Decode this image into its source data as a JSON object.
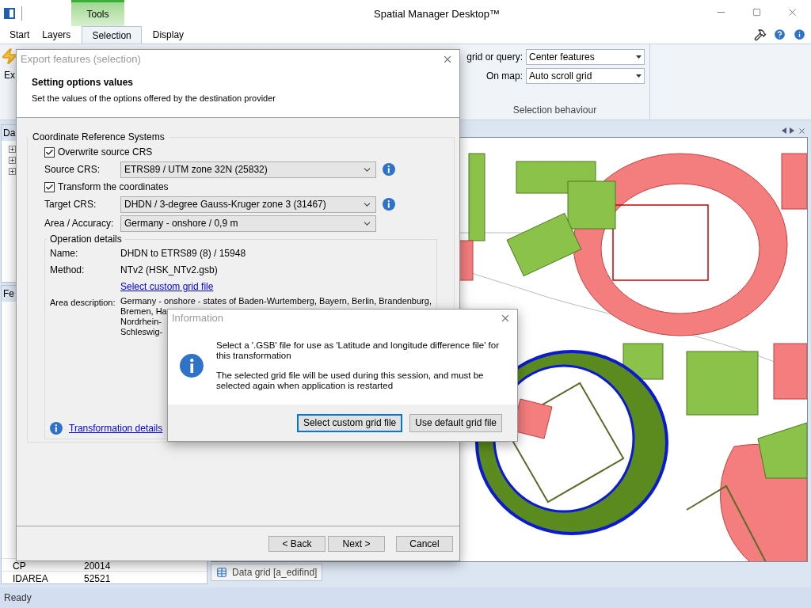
{
  "window": {
    "title": "Spatial Manager Desktop™"
  },
  "contextual_tab": {
    "label": "Tools"
  },
  "tabs": [
    {
      "label": "Start",
      "selected": false
    },
    {
      "label": "Layers",
      "selected": false
    },
    {
      "label": "Selection",
      "selected": true
    },
    {
      "label": "Display",
      "selected": false
    }
  ],
  "ribbon": {
    "partial_label": "Ex",
    "fields": [
      {
        "label": "grid or query:",
        "value": "Center features"
      },
      {
        "label": "On map:",
        "value": "Auto scroll grid"
      }
    ],
    "group_title": "Selection behaviour"
  },
  "left_panel": {
    "data_header": "Da",
    "features_header": "Fe",
    "grid_rows": [
      {
        "name": "CP",
        "value": "20014"
      },
      {
        "name": "IDAREA",
        "value": "52521"
      }
    ]
  },
  "document_tab": {
    "label": "Data grid [a_edifind]"
  },
  "status_bar": {
    "text": "Ready"
  },
  "export_dialog": {
    "title": "Export features (selection)",
    "heading": "Setting options values",
    "subtitle": "Set the values of the options offered by the destination provider",
    "crs_group": {
      "title": "Coordinate Reference Systems",
      "rows": [
        {
          "kind": "checkbox",
          "label": "Overwrite source CRS",
          "checked": true
        },
        {
          "kind": "combo",
          "label": "Source CRS:",
          "value": "ETRS89 / UTM zone 32N (25832)",
          "info": true
        },
        {
          "kind": "checkbox",
          "label": "Transform the coordinates",
          "checked": true
        },
        {
          "kind": "combo",
          "label": "Target CRS:",
          "value": "DHDN / 3-degree Gauss-Kruger zone 3 (31467)",
          "info": true
        },
        {
          "kind": "combo",
          "label": "Area / Accuracy:",
          "value": "Germany - onshore / 0,9 m",
          "info": false
        }
      ]
    },
    "operation_details": {
      "title": "Operation details",
      "name_label": "Name:",
      "name": "DHDN to ETRS89 (8) / 15948",
      "method_label": "Method:",
      "method": "NTv2 (HSK_NTv2.gsb)",
      "grid_link": "Select custom grid file",
      "area_label": "Area description:",
      "area_lines": [
        "Germany - onshore - states of Baden-Wurtemberg, Bayern, Berlin, Brandenburg,",
        "Bremen, Ha",
        "Nordrhein-",
        "Schleswig-"
      ]
    },
    "details_link": "Transformation details",
    "buttons": [
      "< Back",
      "Next >",
      "Cancel"
    ]
  },
  "info_dialog": {
    "title": "Information",
    "messages": [
      "Select a '.GSB' file for use as 'Latitude and longitude difference file' for this transformation",
      "The selected grid file will be used during this session, and must be selected again when application is restarted"
    ],
    "buttons": [
      {
        "label": "Select custom grid file",
        "default": true
      },
      {
        "label": "Use default grid file",
        "default": false
      }
    ]
  }
}
